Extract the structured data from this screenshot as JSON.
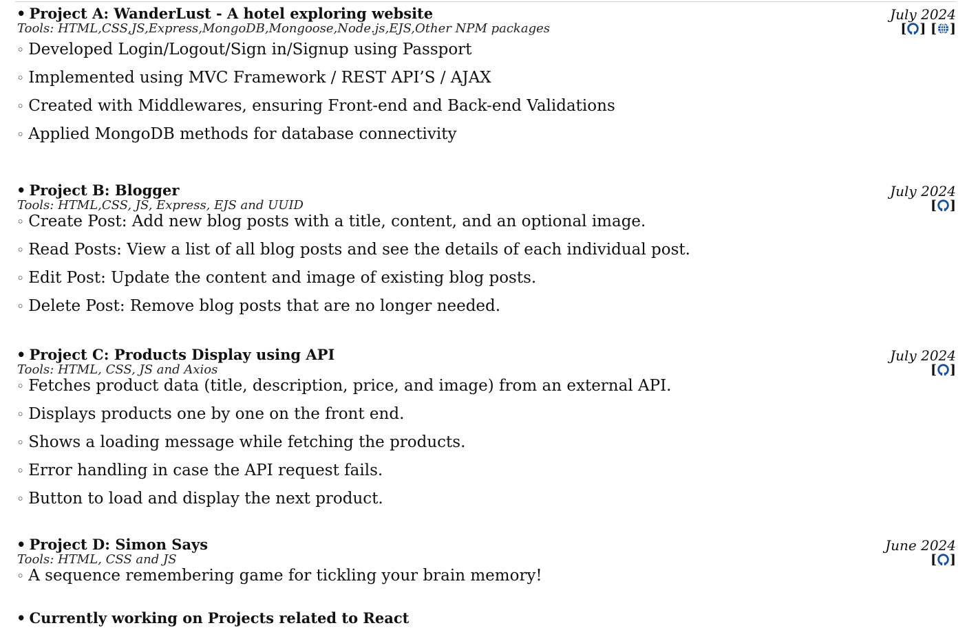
{
  "projects": [
    {
      "title": "Project A: WanderLust - A hotel exploring website",
      "date": "July 2024",
      "tools": "Tools: HTML,CSS,JS,Express,MongoDB,Mongoose,Node.js,EJS,Other NPM packages",
      "links": [
        "github-icon",
        "globe-icon"
      ],
      "bullets": [
        "Developed Login/Logout/Sign in/Signup using Passport",
        "Implemented using MVC Framework / REST API’S / AJAX",
        "Created with Middlewares, ensuring Front-end and Back-end Validations",
        "Applied MongoDB methods for database connectivity"
      ]
    },
    {
      "title": "Project B: Blogger",
      "date": "July 2024",
      "tools": "Tools: HTML,CSS, JS, Express, EJS and UUID",
      "links": [
        "github-icon"
      ],
      "bullets": [
        "Create Post: Add new blog posts with a title, content, and an optional image.",
        "Read Posts: View a list of all blog posts and see the details of each individual post.",
        "Edit Post: Update the content and image of existing blog posts.",
        "Delete Post: Remove blog posts that are no longer needed."
      ]
    },
    {
      "title": "Project C: Products Display using API",
      "date": "July 2024",
      "tools": "Tools: HTML, CSS, JS and Axios",
      "links": [
        "github-icon"
      ],
      "bullets": [
        "Fetches product data (title, description, price, and image) from an external API.",
        "Displays products one by one on the front end.",
        "Shows a loading message while fetching the products.",
        "Error handling in case the API request fails.",
        "Button to load and display the next product."
      ]
    },
    {
      "title": "Project D: Simon Says",
      "date": "June 2024",
      "tools": "Tools: HTML, CSS and JS",
      "links": [
        "github-icon"
      ],
      "bullets": [
        "A sequence remembering game for tickling your brain memory!"
      ]
    }
  ],
  "footer_item": "Currently working on Projects related to React",
  "colors": {
    "link": "#1a4fa0",
    "text": "#111111",
    "rule": "#d4d4d4"
  }
}
